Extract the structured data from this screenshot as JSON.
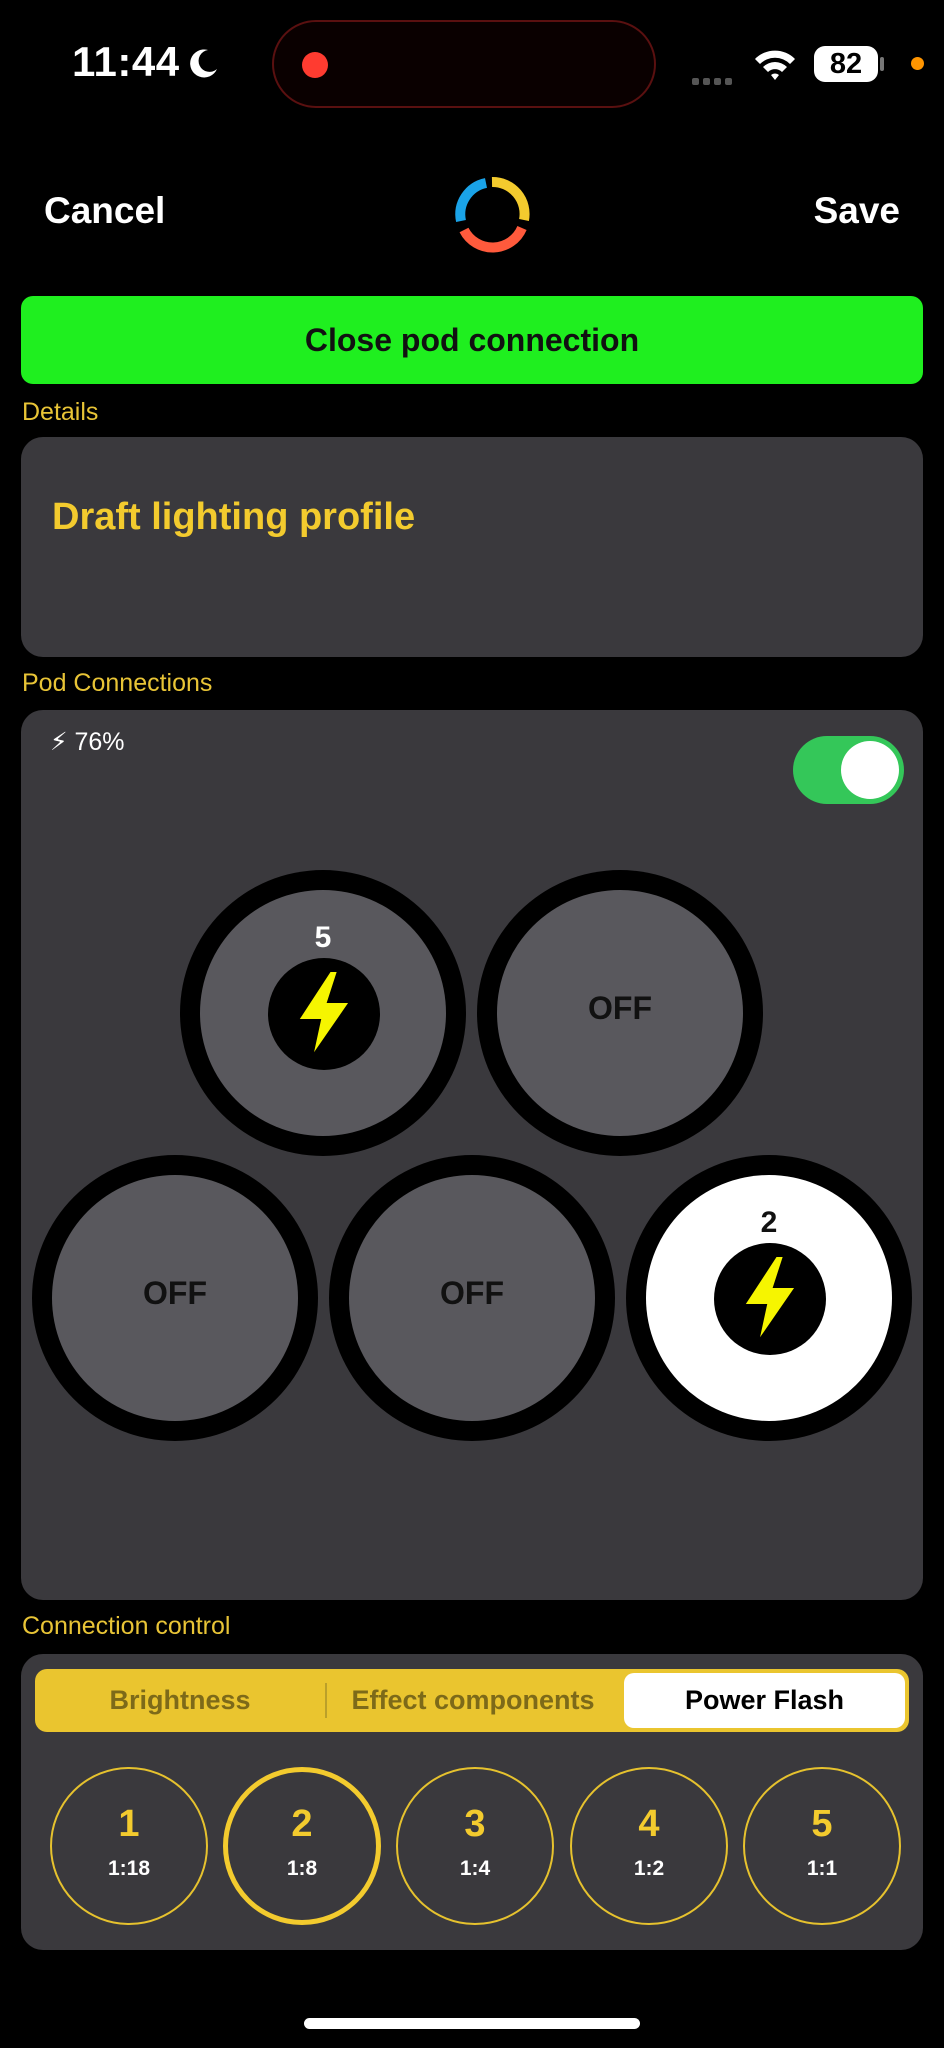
{
  "status_bar": {
    "time": "11:44",
    "battery": "82"
  },
  "nav": {
    "cancel": "Cancel",
    "save": "Save"
  },
  "close_button": "Close pod connection",
  "details": {
    "label": "Details",
    "title": "Draft lighting profile"
  },
  "pod_connections": {
    "label": "Pod Connections",
    "charge": "⚡ 76%",
    "toggle_on": true,
    "pods": [
      {
        "number": "5",
        "state": "flash"
      },
      {
        "status": "OFF"
      },
      {
        "status": "OFF"
      },
      {
        "status": "OFF"
      },
      {
        "number": "2",
        "state": "flash-selected"
      }
    ]
  },
  "connection_control": {
    "label": "Connection control",
    "tabs": [
      "Brightness",
      "Effect components",
      "Power Flash"
    ],
    "active_tab": "Power Flash",
    "levels": [
      {
        "num": "1",
        "ratio": "1:18"
      },
      {
        "num": "2",
        "ratio": "1:8",
        "selected": true
      },
      {
        "num": "3",
        "ratio": "1:4"
      },
      {
        "num": "4",
        "ratio": "1:2"
      },
      {
        "num": "5",
        "ratio": "1:1"
      }
    ]
  },
  "colors": {
    "accent_yellow": "#f3cb2e",
    "green_button": "#1fef1f",
    "toggle_green": "#34c759"
  }
}
